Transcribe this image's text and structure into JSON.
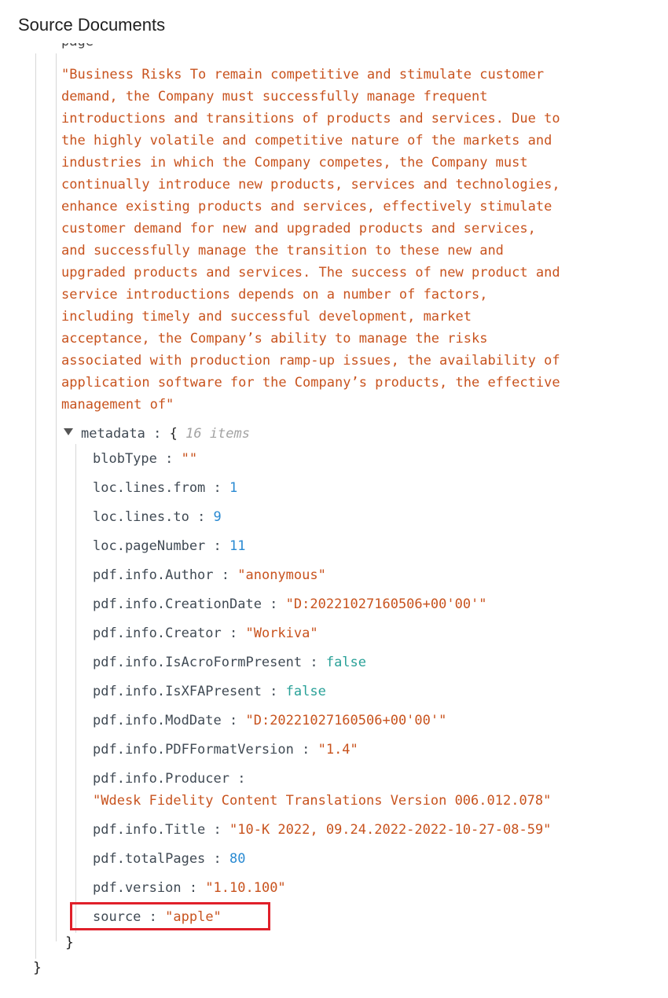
{
  "header": {
    "title": "Source Documents"
  },
  "page_content": {
    "partial_key": "pageContent",
    "text": "\"Business Risks To remain competitive and stimulate customer\ndemand, the Company must successfully manage frequent\nintroductions and transitions of products and services. Due to\nthe highly volatile and competitive nature of the markets and\nindustries in which the Company competes, the Company must\ncontinually introduce new products, services and technologies,\nenhance existing products and services, effectively stimulate\ncustomer demand for new and upgraded products and services,\nand successfully manage the transition to these new and\nupgraded products and services. The success of new product and\nservice introductions depends on a number of factors,\nincluding timely and successful development, market\nacceptance, the Company’s ability to manage the risks\nassociated with production ramp-up issues, the availability of\napplication software for the Company’s products, the effective\nmanagement of\""
  },
  "metadata": {
    "key": "metadata",
    "separator": " : ",
    "open_brace": "{",
    "close_brace": "}",
    "items_count": "16 items",
    "fields": [
      {
        "key": "blobType",
        "value": "\"\"",
        "type": "string"
      },
      {
        "key": "loc.lines.from",
        "value": "1",
        "type": "number"
      },
      {
        "key": "loc.lines.to",
        "value": "9",
        "type": "number"
      },
      {
        "key": "loc.pageNumber",
        "value": "11",
        "type": "number"
      },
      {
        "key": "pdf.info.Author",
        "value": "\"anonymous\"",
        "type": "string"
      },
      {
        "key": "pdf.info.CreationDate",
        "value": "\"D:20221027160506+00'00'\"",
        "type": "string"
      },
      {
        "key": "pdf.info.Creator",
        "value": "\"Workiva\"",
        "type": "string"
      },
      {
        "key": "pdf.info.IsAcroFormPresent",
        "value": "false",
        "type": "boolean"
      },
      {
        "key": "pdf.info.IsXFAPresent",
        "value": "false",
        "type": "boolean"
      },
      {
        "key": "pdf.info.ModDate",
        "value": "\"D:20221027160506+00'00'\"",
        "type": "string"
      },
      {
        "key": "pdf.info.PDFFormatVersion",
        "value": "\"1.4\"",
        "type": "string"
      },
      {
        "key": "pdf.info.Producer",
        "value": "\"Wdesk Fidelity Content Translations Version 006.012.078\"",
        "type": "string"
      },
      {
        "key": "pdf.info.Title",
        "value": "\"10-K 2022, 09.24.2022-2022-10-27-08-59\"",
        "type": "string"
      },
      {
        "key": "pdf.totalPages",
        "value": "80",
        "type": "number"
      },
      {
        "key": "pdf.version",
        "value": "\"1.10.100\"",
        "type": "string"
      },
      {
        "key": "source",
        "value": "\"apple\"",
        "type": "string"
      }
    ]
  },
  "root_close_brace": "}",
  "colors": {
    "string": "#c8531e",
    "number": "#2a8ad2",
    "boolean": "#2aa198",
    "key": "#404a54",
    "highlight_border": "#e0202a"
  }
}
